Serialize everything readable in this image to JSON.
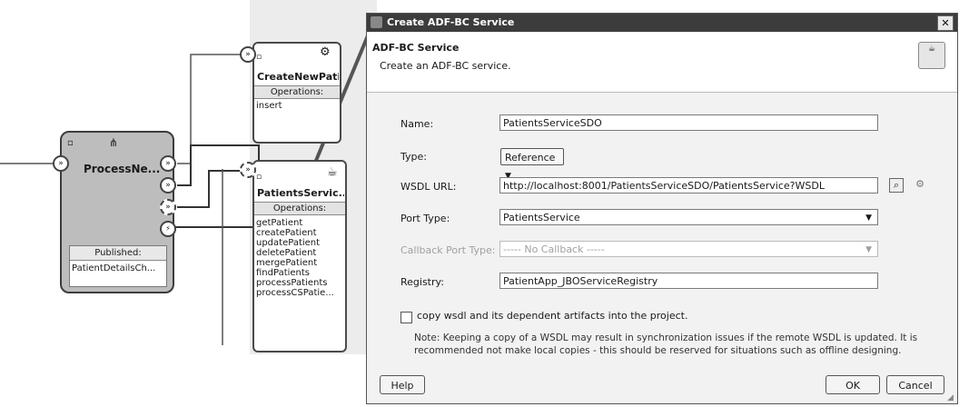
{
  "composite": {
    "create_component": {
      "title": "CreateNewPati...",
      "ops_header": "Operations:",
      "operations": [
        "insert"
      ]
    },
    "patients_component": {
      "title": "PatientsServic...",
      "ops_header": "Operations:",
      "operations": [
        "getPatient",
        "createPatient",
        "updatePatient",
        "deletePatient",
        "mergePatient",
        "findPatients",
        "processPatients",
        "processCSPatie..."
      ]
    },
    "process_component": {
      "title": "ProcessNe...",
      "published_label": "Published:",
      "published_value": "PatientDetailsCh..."
    }
  },
  "dialog": {
    "title": "Create ADF-BC Service",
    "close_symbol": "✕",
    "header_title": "ADF-BC Service",
    "header_subtitle": "Create an ADF-BC service.",
    "form": {
      "name_label": "Name:",
      "name_value": "PatientsServiceSDO",
      "type_label": "Type:",
      "type_value": "Reference",
      "wsdl_label": "WSDL URL:",
      "wsdl_value": "http://localhost:8001/PatientsServiceSDO/PatientsService?WSDL",
      "port_label": "Port Type:",
      "port_value": "PatientsService",
      "callback_label": "Callback Port Type:",
      "callback_value": "----- No Callback -----",
      "registry_label": "Registry:",
      "registry_value": "PatientApp_JBOServiceRegistry",
      "copy_label": "copy wsdl and its dependent artifacts into the project.",
      "note": "Note: Keeping a copy of a WSDL may result in synchronization issues if the remote WSDL is updated. It is recommended not make local copies - this should be reserved for situations such as offline designing."
    },
    "buttons": {
      "help": "Help",
      "ok": "OK",
      "cancel": "Cancel"
    }
  }
}
